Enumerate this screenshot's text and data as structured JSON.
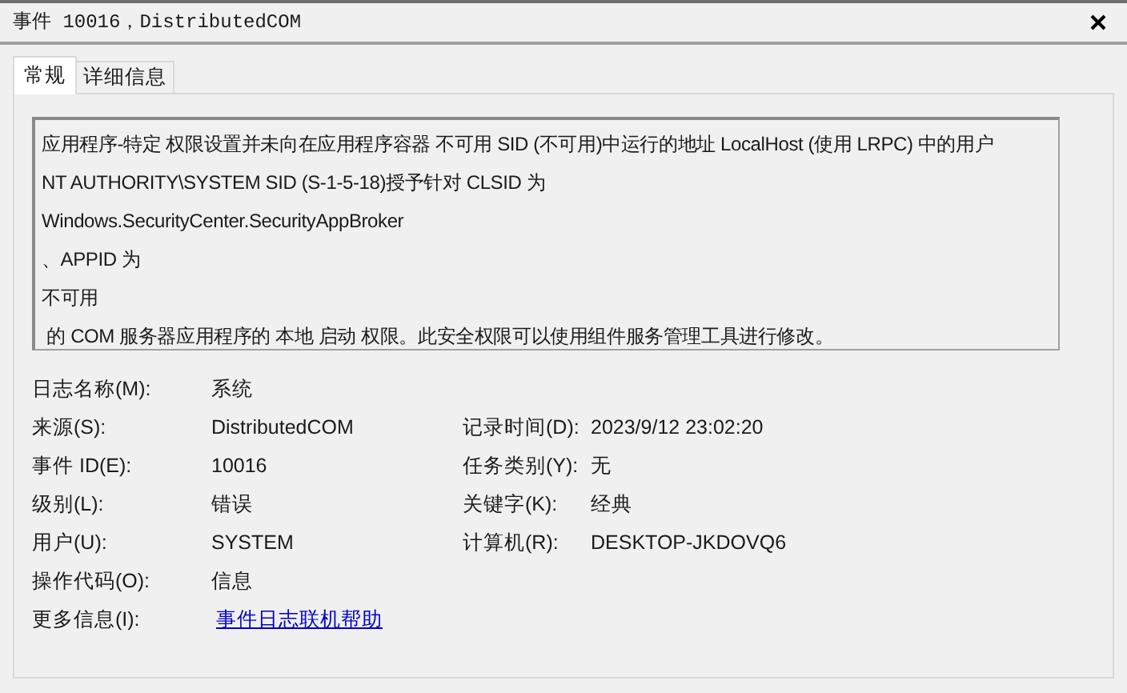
{
  "window": {
    "title": "事件 10016，DistributedCOM"
  },
  "tabs": [
    {
      "label": "常规",
      "selected": true
    },
    {
      "label": "详细信息",
      "selected": false
    }
  ],
  "message_lines": [
    "应用程序-特定 权限设置并未向在应用程序容器 不可用 SID (不可用)中运行的地址 LocalHost (使用 LRPC) 中的用户",
    "NT AUTHORITY\\SYSTEM SID (S-1-5-18)授予针对 CLSID 为",
    "Windows.SecurityCenter.SecurityAppBroker",
    "、APPID 为",
    "不可用",
    " 的 COM 服务器应用程序的 本地 启动 权限。此安全权限可以使用组件服务管理工具进行修改。"
  ],
  "properties": [
    {
      "left": {
        "label": "日志名称(M):",
        "value": "系统",
        "kind": "text"
      }
    },
    {
      "left": {
        "label": "来源(S):",
        "value": "DistributedCOM",
        "kind": "text"
      },
      "right": {
        "label": "记录时间(D):",
        "value": "2023/9/12 23:02:20"
      }
    },
    {
      "left": {
        "label": "事件 ID(E):",
        "value": "10016",
        "kind": "text"
      },
      "right": {
        "label": "任务类别(Y):",
        "value": "无"
      }
    },
    {
      "left": {
        "label": "级别(L):",
        "value": "错误",
        "kind": "text"
      },
      "right": {
        "label": "关键字(K):",
        "value": "经典"
      }
    },
    {
      "left": {
        "label": "用户(U):",
        "value": "SYSTEM",
        "kind": "text"
      },
      "right": {
        "label": "计算机(R):",
        "value": "DESKTOP-JKDOVQ6"
      }
    },
    {
      "left": {
        "label": "操作代码(O):",
        "value": "信息",
        "kind": "text"
      }
    },
    {
      "left": {
        "label": "更多信息(I):",
        "value": "事件日志联机帮助",
        "kind": "link"
      }
    }
  ]
}
